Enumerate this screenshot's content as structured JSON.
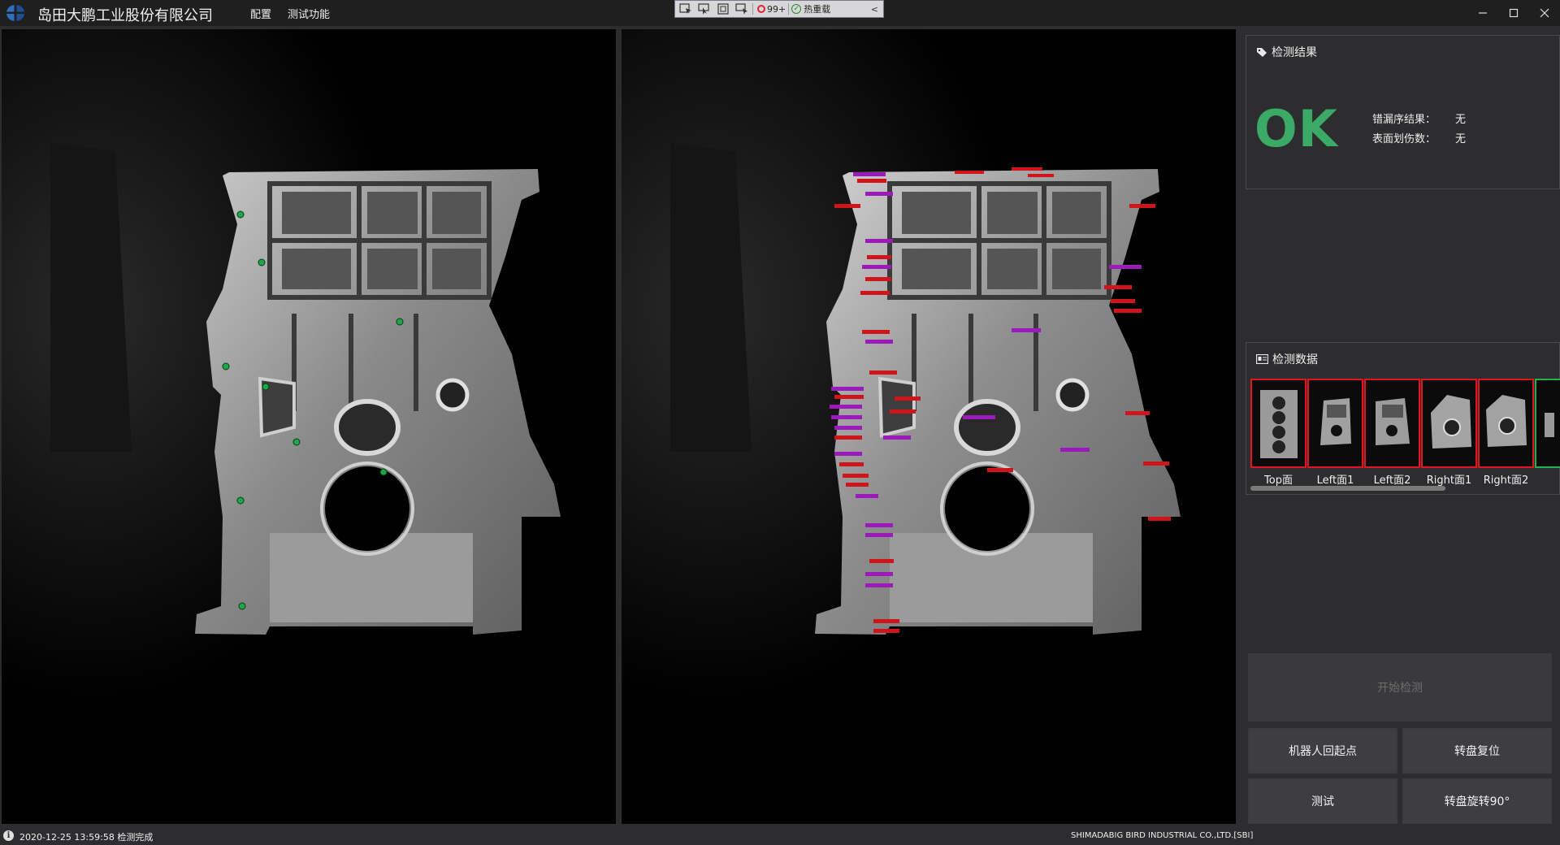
{
  "app": {
    "title": "岛田大鹏工业股份有限公司",
    "menu": [
      "配置",
      "测试功能"
    ]
  },
  "debug_toolbar": {
    "badge": "99+",
    "reload": "热重载"
  },
  "result": {
    "header": "检测结果",
    "status": "OK",
    "status_color": "#3aaa66",
    "rows": [
      {
        "label": "错漏序结果：",
        "value": "无"
      },
      {
        "label": "表面划伤数：",
        "value": "无"
      }
    ]
  },
  "data": {
    "header": "检测数据",
    "thumbnails": [
      {
        "label": "Top面",
        "border": "#e0151f"
      },
      {
        "label": "Left面1",
        "border": "#e0151f"
      },
      {
        "label": "Left面2",
        "border": "#e0151f"
      },
      {
        "label": "Right面1",
        "border": "#e0151f"
      },
      {
        "label": "Right面2",
        "border": "#e0151f"
      },
      {
        "label": "",
        "border": "#1bb44a"
      }
    ]
  },
  "buttons": {
    "start": "开始检测",
    "robot_home": "机器人回起点",
    "turntable_reset": "转盘复位",
    "test": "测试",
    "turntable_rotate": "转盘旋转90°"
  },
  "status": {
    "message": "2020-12-25 13:59:58 检测完成",
    "company": "SHIMADABIG BIRD INDUSTRIAL CO.,LTD.[SBI]"
  }
}
